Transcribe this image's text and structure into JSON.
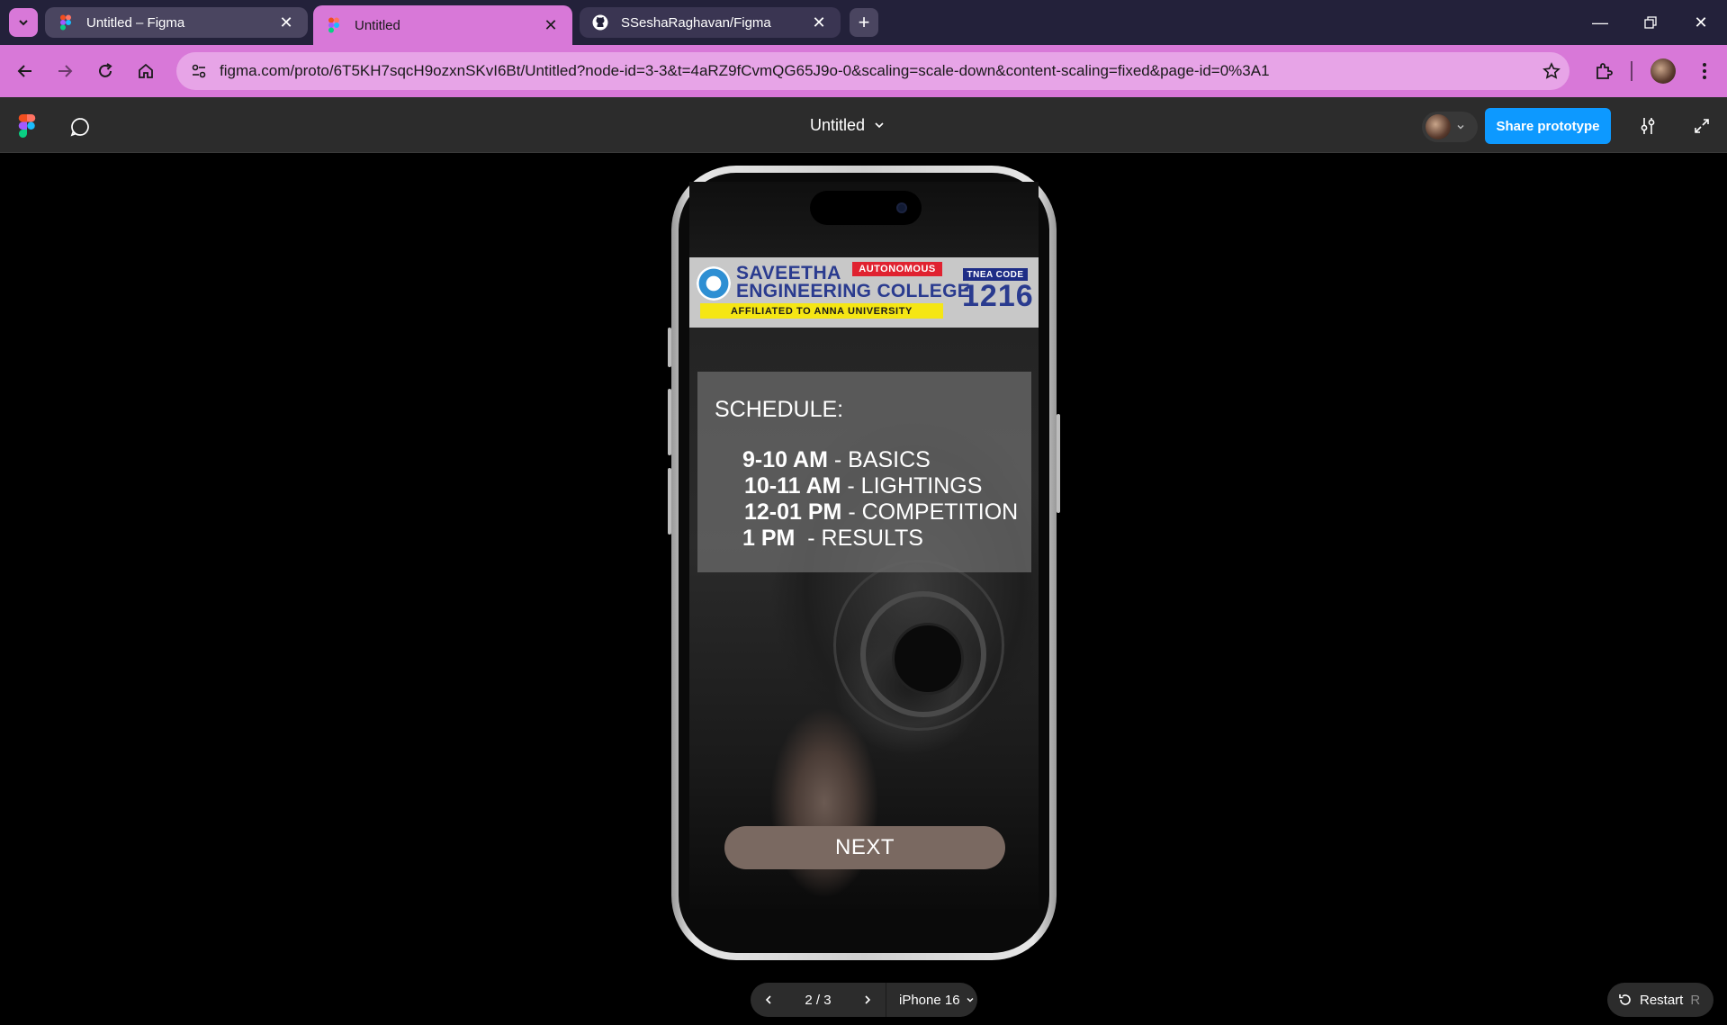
{
  "browser": {
    "tabs": [
      {
        "title": "Untitled – Figma",
        "icon": "figma-icon",
        "active": false
      },
      {
        "title": "Untitled",
        "icon": "figma-icon",
        "active": true
      },
      {
        "title": "SSeshaRaghavan/Figma",
        "icon": "github-icon",
        "active": false
      }
    ],
    "url": "figma.com/proto/6T5KH7sqcH9ozxnSKvI6Bt/Untitled?node-id=3-3&t=4aRZ9fCvmQG65J9o-0&scaling=scale-down&content-scaling=fixed&page-id=0%3A1",
    "accent_color": "#d878d8"
  },
  "figma": {
    "file_title": "Untitled",
    "share_label": "Share prototype",
    "share_color": "#0d99ff"
  },
  "prototype": {
    "banner": {
      "name_line1": "SAVEETHA",
      "name_line2": "ENGINEERING COLLEGE",
      "autonomous": "AUTONOMOUS",
      "affiliation": "AFFILIATED TO ANNA UNIVERSITY",
      "tnea_label": "TNEA CODE",
      "tnea_code": "1216"
    },
    "schedule": {
      "title": "SCHEDULE:",
      "items": [
        {
          "time": "9-10 AM",
          "activity": " - BASICS"
        },
        {
          "time": "10-11 AM",
          "activity": " - LIGHTINGS"
        },
        {
          "time": "12-01 PM",
          "activity": " - COMPETITION"
        },
        {
          "time": "1 PM",
          "activity": "  - RESULTS"
        }
      ]
    },
    "next_label": "NEXT",
    "next_color": "#7a6961"
  },
  "controls": {
    "page_counter": "2 / 3",
    "device": "iPhone 16",
    "restart_label": "Restart",
    "restart_key": "R"
  }
}
